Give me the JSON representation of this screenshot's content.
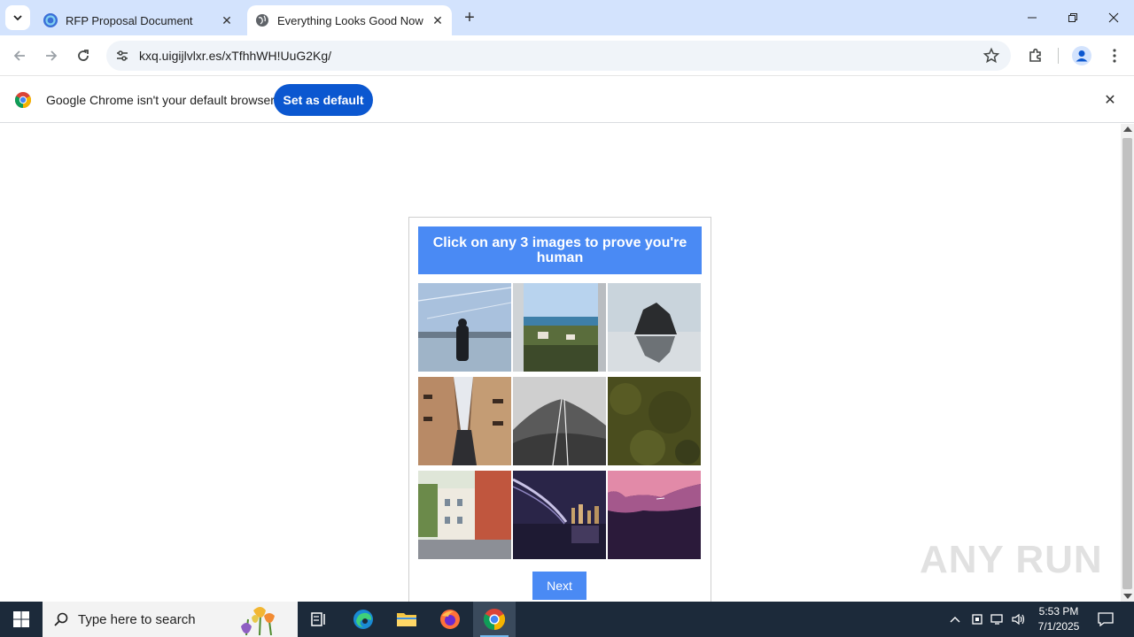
{
  "browser": {
    "tabs": [
      {
        "title": "RFP Proposal Document",
        "active": false
      },
      {
        "title": "Everything Looks Good Now",
        "active": true
      }
    ],
    "url": "kxq.uigijlvlxr.es/xTfhhWH!UuG2Kg/"
  },
  "infobar": {
    "message": "Google Chrome isn't your default browser",
    "button_label": "Set as default"
  },
  "captcha": {
    "instruction": "Click on any 3 images to prove you're human",
    "tiles": [
      {
        "subject": "person silhouette at lake"
      },
      {
        "subject": "coastal town with building"
      },
      {
        "subject": "rock island reflection"
      },
      {
        "subject": "narrow street with balconies"
      },
      {
        "subject": "misty mountain trail"
      },
      {
        "subject": "moss texture"
      },
      {
        "subject": "colorful street houses"
      },
      {
        "subject": "bridge at night"
      },
      {
        "subject": "pink clouds dusk"
      }
    ],
    "next_label": "Next"
  },
  "watermark": "ANY RUN",
  "taskbar": {
    "search_placeholder": "Type here to search",
    "time": "5:53 PM",
    "date": "7/1/2025"
  }
}
